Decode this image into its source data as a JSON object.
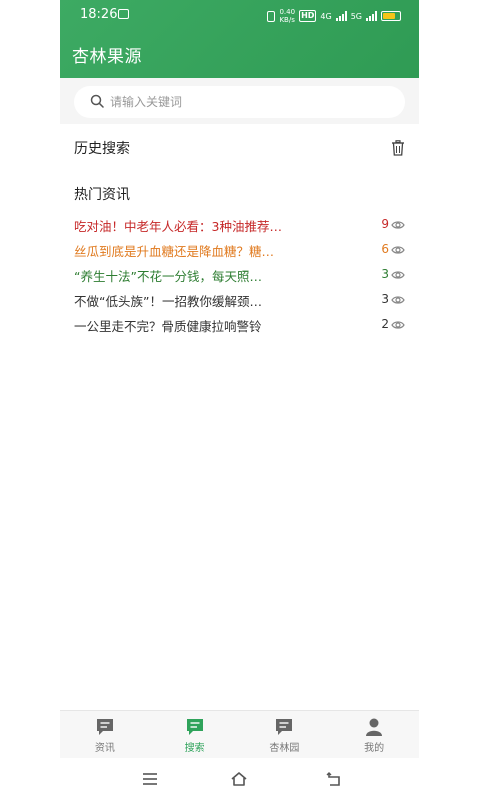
{
  "status_bar": {
    "time": "18:26",
    "speed_value": "0.40",
    "speed_unit": "KB/s",
    "hd": "HD",
    "network_a": "4G",
    "network_b": "5G"
  },
  "app": {
    "title": "杏林果源",
    "accent": "#2fa35b"
  },
  "search": {
    "placeholder": "请输入关键词",
    "value": ""
  },
  "history": {
    "title": "历史搜索"
  },
  "hot": {
    "title": "热门资讯",
    "items": [
      {
        "text": "吃对油！中老年人必看：3种油推荐…",
        "count": "9",
        "color": "#c62828"
      },
      {
        "text": "丝瓜到底是升血糖还是降血糖？糖…",
        "count": "6",
        "color": "#e07a1f"
      },
      {
        "text": "“养生十法”不花一分钱，每天照…",
        "count": "3",
        "color": "#2e7d32"
      },
      {
        "text": "不做“低头族”！一招教你缓解颈…",
        "count": "3",
        "color": "#333333"
      },
      {
        "text": "一公里走不完？骨质健康拉响警铃",
        "count": "2",
        "color": "#333333"
      }
    ]
  },
  "tabbar": {
    "tabs": [
      {
        "label": "资讯",
        "icon": "chat-icon",
        "active": false
      },
      {
        "label": "搜索",
        "icon": "chat-icon",
        "active": true
      },
      {
        "label": "杏林园",
        "icon": "chat-icon",
        "active": false
      },
      {
        "label": "我的",
        "icon": "person-icon",
        "active": false
      }
    ]
  }
}
